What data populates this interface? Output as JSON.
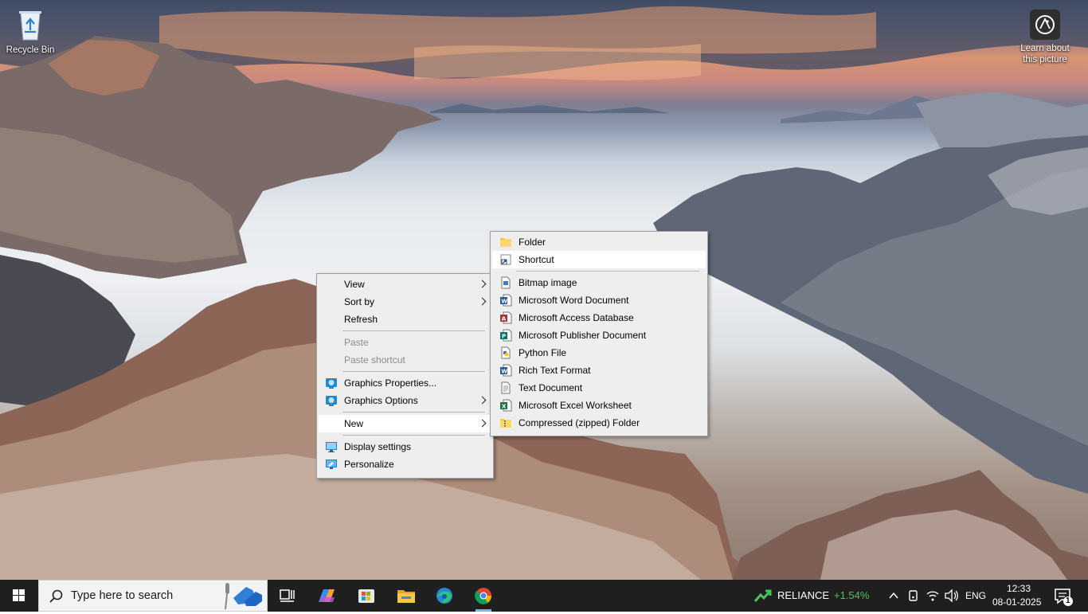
{
  "desktop": {
    "icons": [
      {
        "label": "Recycle Bin",
        "icon": "recycle-bin-icon"
      },
      {
        "label": "Learn about this picture",
        "icon": "camera-icon"
      }
    ]
  },
  "context_menu": {
    "items": [
      {
        "label": "View",
        "has_submenu": true
      },
      {
        "label": "Sort by",
        "has_submenu": true
      },
      {
        "label": "Refresh"
      },
      {
        "label": "Paste",
        "disabled": true
      },
      {
        "label": "Paste shortcut",
        "disabled": true
      },
      {
        "label": "Graphics Properties...",
        "icon": "intel-graphics-icon"
      },
      {
        "label": "Graphics Options",
        "icon": "intel-graphics-icon",
        "has_submenu": true
      },
      {
        "label": "New",
        "has_submenu": true,
        "highlighted": true
      },
      {
        "label": "Display settings",
        "icon": "display-settings-icon"
      },
      {
        "label": "Personalize",
        "icon": "personalize-icon"
      }
    ]
  },
  "new_submenu": {
    "items": [
      {
        "label": "Folder",
        "icon": "folder-icon"
      },
      {
        "label": "Shortcut",
        "icon": "shortcut-icon",
        "highlighted": true
      },
      {
        "label": "Bitmap image",
        "icon": "bitmap-icon"
      },
      {
        "label": "Microsoft Word Document",
        "icon": "word-icon"
      },
      {
        "label": "Microsoft Access Database",
        "icon": "access-icon"
      },
      {
        "label": "Microsoft Publisher Document",
        "icon": "publisher-icon"
      },
      {
        "label": "Python File",
        "icon": "python-icon"
      },
      {
        "label": "Rich Text Format",
        "icon": "rtf-icon"
      },
      {
        "label": "Text Document",
        "icon": "text-document-icon"
      },
      {
        "label": "Microsoft Excel Worksheet",
        "icon": "excel-icon"
      },
      {
        "label": "Compressed (zipped) Folder",
        "icon": "zip-folder-icon"
      }
    ]
  },
  "taskbar": {
    "search_placeholder": "Type here to search",
    "apps": [
      "task-view-icon",
      "copilot-icon",
      "microsoft-store-icon",
      "file-explorer-icon",
      "edge-icon",
      "chrome-icon"
    ],
    "stock": {
      "name": "RELIANCE",
      "change": "+1.54%"
    },
    "language": "ENG",
    "time": "12:33",
    "date": "08-01-2025",
    "notification_count": "1"
  },
  "colors": {
    "menu_bg": "#eeeeee",
    "menu_hover": "#ffffff",
    "taskbar_bg": "#1f1f1f",
    "stock_positive": "#4cc35a"
  }
}
